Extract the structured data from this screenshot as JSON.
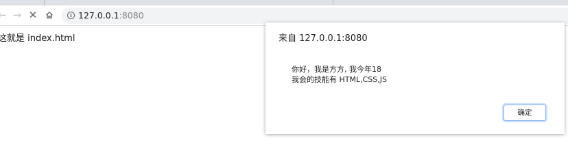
{
  "browser": {
    "url_host": "127.0.0.1",
    "url_port": ":8080",
    "icons": {
      "back": "arrow-left-icon",
      "forward": "arrow-right-icon",
      "stop": "close-icon",
      "home": "home-icon",
      "site_info": "info-icon"
    }
  },
  "page": {
    "body_text": "这就是 index.html"
  },
  "alert": {
    "title": "来自 127.0.0.1:8080",
    "message_lines": [
      "你好，我是方方, 我今年18",
      "我会的技能有 HTML,CSS,JS"
    ],
    "ok_label": "确定",
    "ok_focus_color": "#86b4ea"
  }
}
